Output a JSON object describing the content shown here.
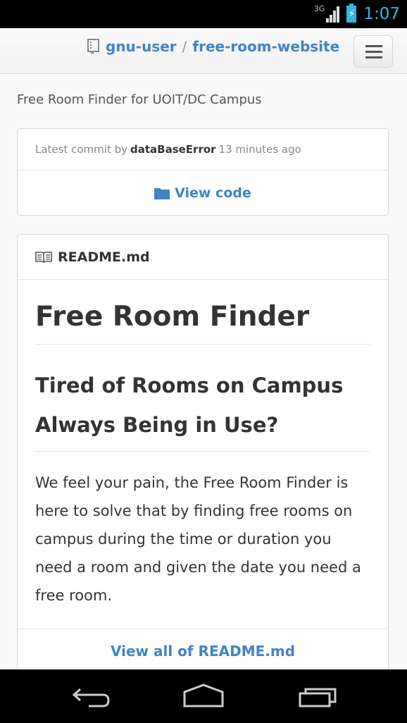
{
  "status_bar": {
    "network": "3G",
    "time": "1:07",
    "accent_color": "#33b5e5"
  },
  "header": {
    "repo_icon": "repo-book-icon",
    "owner": "gnu-user",
    "separator": "/",
    "repo": "free-room-website",
    "menu_icon": "hamburger-menu-icon",
    "link_color": "#4183c4"
  },
  "description": "Free Room Finder for UOIT/DC Campus",
  "commit": {
    "prefix": "Latest commit by",
    "author": "dataBaseError",
    "time": "13 minutes ago",
    "view_code_icon": "folder-icon",
    "view_code_label": "View code"
  },
  "readme": {
    "icon": "book-open-icon",
    "filename": "README.md",
    "h1": "Free Room Finder",
    "h2": "Tired of Rooms on Campus Always Being in Use?",
    "paragraph": "We feel your pain, the Free Room Finder is here to solve that by finding free rooms on campus during the time or duration you need a room and given the date you need a free room.",
    "view_all_label": "View all of README.md"
  },
  "nav_bar": {
    "back_icon": "back-icon",
    "home_icon": "home-icon",
    "recents_icon": "recent-apps-icon"
  }
}
